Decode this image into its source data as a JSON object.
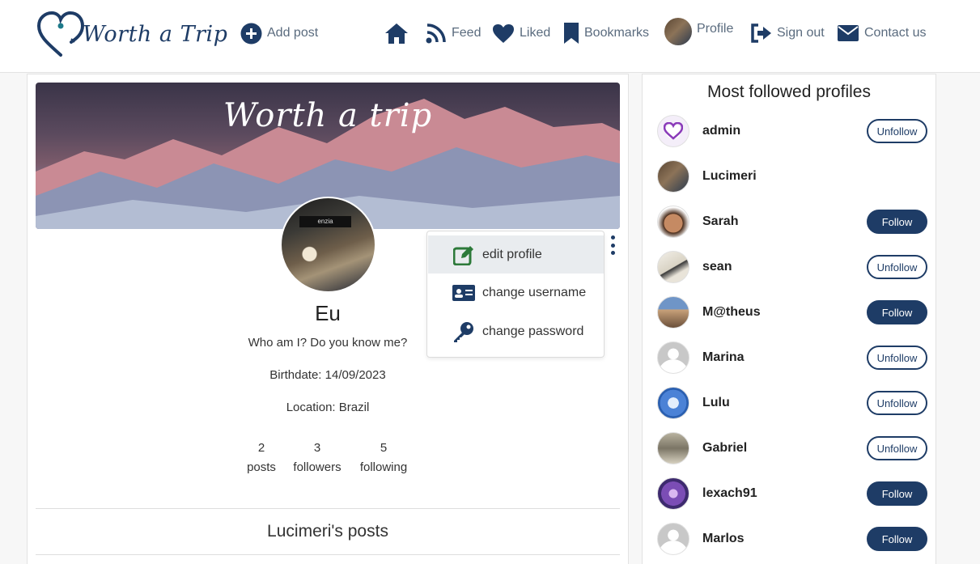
{
  "brand": {
    "name": "Worth a Trip",
    "color": "#1e3c66"
  },
  "nav": {
    "add_post": "Add post",
    "feed": "Feed",
    "liked": "Liked",
    "bookmarks": "Bookmarks",
    "profile": "Profile",
    "sign_out": "Sign out",
    "contact": "Contact us"
  },
  "banner": {
    "title": "Worth a trip"
  },
  "profile": {
    "name": "Eu",
    "bio": "Who am I? Do you know me?",
    "birthdate": "Birthdate: 14/09/2023",
    "location": "Location: Brazil",
    "avatar_sign": "enzia",
    "stats": [
      {
        "value": "2",
        "label": "posts"
      },
      {
        "value": "3",
        "label": "followers"
      },
      {
        "value": "5",
        "label": "following"
      }
    ],
    "posts_title": "Lucimeri's posts"
  },
  "menu": {
    "edit": "edit profile",
    "username": "change username",
    "password": "change password"
  },
  "sidebar": {
    "title": "Most followed profiles",
    "users": [
      {
        "name": "admin",
        "action": "Unfollow"
      },
      {
        "name": "Lucimeri",
        "action": ""
      },
      {
        "name": "Sarah",
        "action": "Follow"
      },
      {
        "name": "sean",
        "action": "Unfollow"
      },
      {
        "name": "M@theus",
        "action": "Follow"
      },
      {
        "name": "Marina",
        "action": "Unfollow"
      },
      {
        "name": "Lulu",
        "action": "Unfollow"
      },
      {
        "name": "Gabriel",
        "action": "Unfollow"
      },
      {
        "name": "lexach91",
        "action": "Follow"
      },
      {
        "name": "Marlos",
        "action": "Follow"
      }
    ]
  }
}
